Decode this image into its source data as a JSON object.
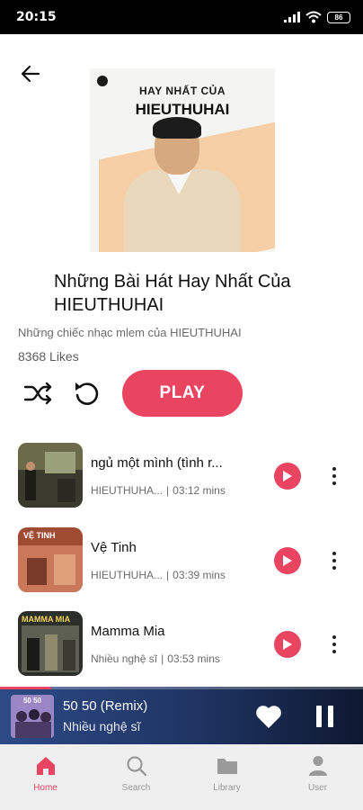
{
  "status_bar": {
    "time": "20:15",
    "battery": "86"
  },
  "cover": {
    "line1": "HAY NHẤT CỦA",
    "line2": "HIEUTHUHAI"
  },
  "playlist": {
    "title": "Những Bài Hát Hay Nhất Của HIEUTHUHAI",
    "description": "Những chiếc nhạc mlem của HIEUTHUHAI",
    "likes": "8368 Likes",
    "play_label": "PLAY"
  },
  "songs": [
    {
      "title": "ngủ một mình (tình r...",
      "artist": "HIEUTHUHA...",
      "separator": "|",
      "duration": "03:12 mins"
    },
    {
      "title": "Vệ Tinh",
      "artist": "HIEUTHUHA...",
      "separator": "|",
      "duration": "03:39 mins",
      "thumb_text": "VỆ TINH"
    },
    {
      "title": "Mamma Mia",
      "artist": "Nhiều nghệ sĩ",
      "separator": "|",
      "duration": "03:53 mins",
      "thumb_text": "MAMMA MIA"
    }
  ],
  "now_playing": {
    "title": "50 50 (Remix)",
    "artist": "Nhiều nghệ sĩ",
    "cover_text": "50 50",
    "progress": 0.14
  },
  "nav": [
    {
      "label": "Home",
      "icon": "home-icon",
      "active": true
    },
    {
      "label": "Search",
      "icon": "search-icon",
      "active": false
    },
    {
      "label": "Library",
      "icon": "folder-icon",
      "active": false
    },
    {
      "label": "User",
      "icon": "user-icon",
      "active": false
    }
  ],
  "colors": {
    "accent": "#e94560",
    "nav_bg": "#efefef",
    "player_bg": "#1f3462"
  }
}
